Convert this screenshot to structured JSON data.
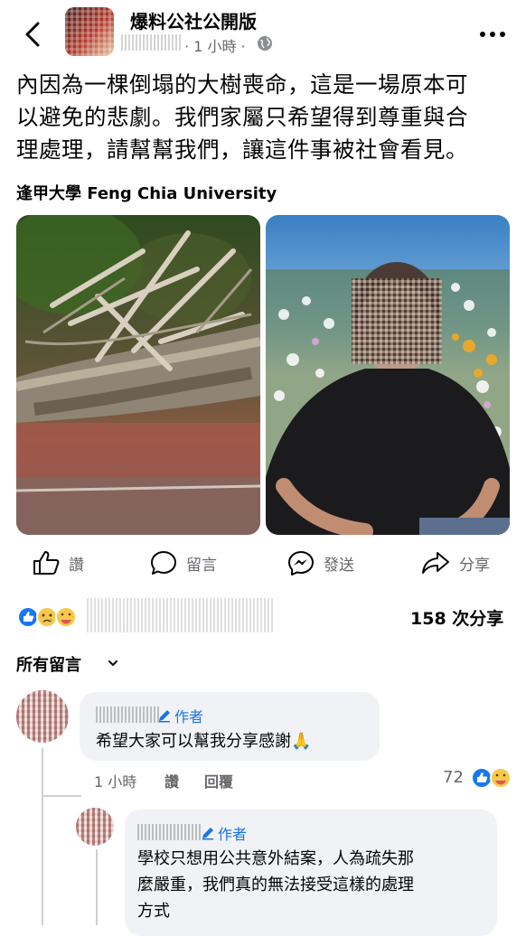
{
  "header": {
    "group_name": "爆料公社公開版",
    "time_ago": "· 1 小時 ·"
  },
  "post": {
    "text_lines": [
      "內因為一棵倒塌的大樹喪命，這是一場原本可",
      "以避免的悲劇。我們家屬只希望得到尊重與合",
      "理處理，請幫幫我們，讓這件事被社會看見。"
    ],
    "source_label": "逢甲大學 Feng Chia University"
  },
  "actions": {
    "like": "讚",
    "comment": "留言",
    "send": "發送",
    "share": "分享"
  },
  "stats": {
    "share_count": "158 次分享"
  },
  "comments_header": "所有留言",
  "comments": [
    {
      "badge": "作者",
      "text": "希望大家可以幫我分享感謝🙏",
      "time": "1 小時",
      "like": "讚",
      "reply": "回覆",
      "reaction_count": "72"
    },
    {
      "badge": "作者",
      "lines": [
        "學校只想用公共意外結案，人為疏失那",
        "麼嚴重，我們真的無法接受這樣的處理",
        "方式"
      ]
    }
  ],
  "colors": {
    "accent": "#1b74e4",
    "like_blue": "#1877f2",
    "meta_gray": "#65676b",
    "bubble": "#f0f2f5"
  }
}
